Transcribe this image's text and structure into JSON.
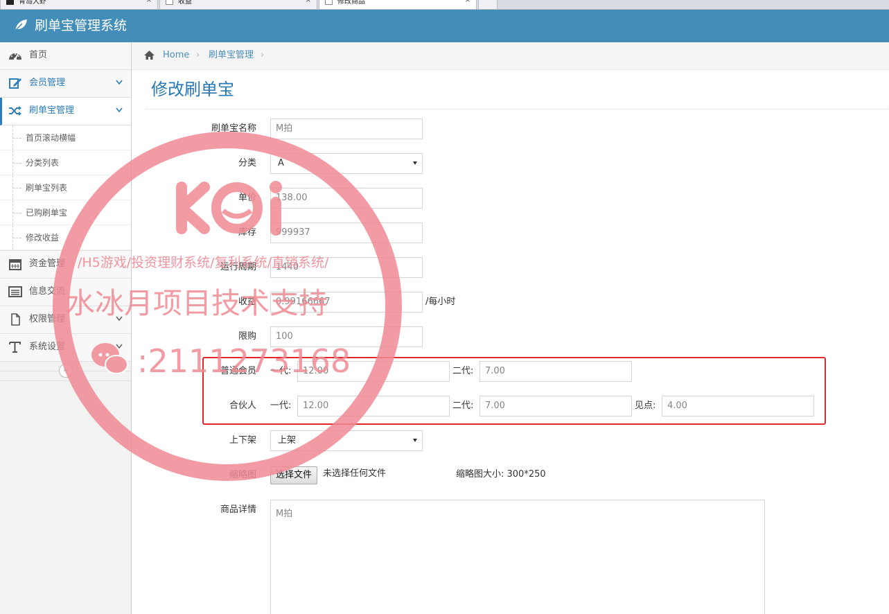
{
  "browser_tabs": [
    {
      "label": "青岛大虾",
      "active": false
    },
    {
      "label": "收益",
      "active": false
    },
    {
      "label": "修改商品",
      "active": true
    }
  ],
  "app": {
    "title": "刷单宝管理系统"
  },
  "sidebar": {
    "items": [
      {
        "label": "首页",
        "icon": "dashboard-icon"
      },
      {
        "label": "会员管理",
        "icon": "edit-icon"
      },
      {
        "label": "刷单宝管理",
        "icon": "shuffle-icon",
        "active": true
      },
      {
        "label": "资金管理",
        "icon": "calendar-icon"
      },
      {
        "label": "信息交流",
        "icon": "list-alt-icon"
      },
      {
        "label": "权限管理",
        "icon": "file-icon"
      },
      {
        "label": "系统设置",
        "icon": "text-icon"
      }
    ],
    "submenu": [
      "首页滚动横幅",
      "分类列表",
      "刷单宝列表",
      "已购刷单宝",
      "修改收益"
    ],
    "collapse_glyph": "«"
  },
  "breadcrumb": {
    "home": "Home",
    "current": "刷单宝管理",
    "sep": "›"
  },
  "page": {
    "title": "修改刷单宝"
  },
  "form": {
    "name": {
      "label": "刷单宝名称",
      "value": "M拍"
    },
    "category": {
      "label": "分类",
      "value": "A"
    },
    "price": {
      "label": "单价",
      "value": "138.00"
    },
    "stock": {
      "label": "库存",
      "value": "999937"
    },
    "period": {
      "label": "运行周期",
      "value": "1440"
    },
    "income": {
      "label": "收益",
      "value": "0.99166667",
      "suffix": "/每小时"
    },
    "limit": {
      "label": "限购",
      "value": "100"
    },
    "member": {
      "label": "普通会员",
      "gen1_label": "一代:",
      "gen1": "12.00",
      "gen2_label": "二代:",
      "gen2": "7.00"
    },
    "partner": {
      "label": "合伙人",
      "gen1_label": "一代:",
      "gen1": "12.00",
      "gen2_label": "二代:",
      "gen2": "7.00",
      "point_label": "见点:",
      "point": "4.00"
    },
    "shelf": {
      "label": "上下架",
      "value": "上架"
    },
    "thumb": {
      "label": "缩略图",
      "button": "选择文件",
      "status": "未选择任何文件",
      "hint": "缩略图大小: 300*250"
    },
    "detail": {
      "label": "商品详情",
      "value": "M拍"
    }
  },
  "watermark": {
    "logo": "K i",
    "line1": "/H5游戏/投资理财系统/复利系统/直销系统/",
    "line2": "水冰月项目技术支持",
    "line3": ":2111273168",
    "color": "#f08a94"
  }
}
